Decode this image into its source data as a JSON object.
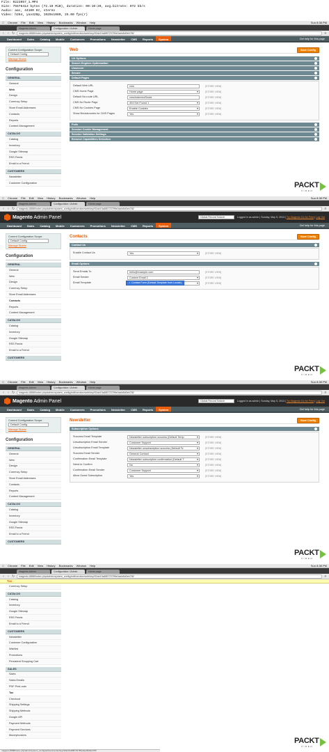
{
  "meta": {
    "lines": [
      "File: 0223057_1.MP4",
      "Size: 75576413 bytes (72.10 MiB), duration: 00:10:20, avg.bitrate: 972 kb/s",
      "Audio: aac, 44100 Hz, stereo",
      "Video: h264, yuv420p, 1920x1080, 25.00 fps(r)"
    ]
  },
  "macbar": {
    "apple": "",
    "items": [
      "Chrome",
      "File",
      "Edit",
      "View",
      "History",
      "Bookmarks",
      "Window",
      "Help"
    ],
    "right": "Sun 8:38 PM"
  },
  "browser": {
    "tabs": [
      "Magento Admin",
      "Configuration / Admin",
      "Home page"
    ],
    "url": "magento.8888/index.php/admin/system_config/edit/section/web/key/92ab19a8f87237ff9e0aeb8d0eb7f8/"
  },
  "header": {
    "logo": "Magento",
    "logo_suffix": "Admin Panel",
    "search_value": "Global Record Search",
    "logged_in": "Logged in as admin",
    "date": "Sunday, May 5, 2013",
    "try_link": "Try Magento Go for Free",
    "logout": "Log Out"
  },
  "nav": {
    "items": [
      "Dashboard",
      "Sales",
      "Catalog",
      "Mobile",
      "Customers",
      "Promotions",
      "Newsletter",
      "CMS",
      "Reports",
      "System"
    ],
    "active": "System",
    "help": "Get help for this page"
  },
  "sidebar": {
    "scope_label": "Current Configuration Scope:",
    "scope_value": "Default Config",
    "manage_stores": "Manage Stores",
    "title": "Configuration",
    "general_head": "GENERAL",
    "general_items": [
      "General",
      "Web",
      "Design",
      "Currency Setup",
      "Store Email Addresses",
      "Contacts",
      "Reports",
      "Content Management"
    ],
    "catalog_head": "CATALOG",
    "catalog_items": [
      "Catalog",
      "Inventory",
      "Google Sitemap",
      "RSS Feeds",
      "Email to a Friend"
    ],
    "customers_head": "CUSTOMERS",
    "customers_items": [
      "Newsletter",
      "Customer Configuration"
    ],
    "customers_items_full": [
      "Newsletter",
      "Customer Configuration",
      "Wishlist",
      "Promotions",
      "Persistent Shopping Cart"
    ],
    "sales_head": "SALES",
    "sales_items": [
      "Sales",
      "Sales Emails",
      "PDF Print-outs",
      "Tax",
      "Checkout",
      "Shipping Settings",
      "Shipping Methods",
      "Google API",
      "Payment Methods",
      "Payment Services",
      "Moneybookers"
    ]
  },
  "save_label": "Save Config",
  "store_view": "[STORE VIEW]",
  "web": {
    "title": "Web",
    "sections_top": [
      "Url Options",
      "Search Engines Optimization",
      "Unsecure",
      "Secure",
      "Default Pages"
    ],
    "rows": [
      {
        "label": "Default Web URL",
        "value": "cms"
      },
      {
        "label": "CMS Home Page",
        "value": "Home page"
      },
      {
        "label": "Default No-route URL",
        "value": "cms/index/noRoute"
      },
      {
        "label": "CMS No Route Page",
        "value": "404 Not Found 1"
      },
      {
        "label": "CMS No Cookies Page",
        "value": "Enable Cookies"
      },
      {
        "label": "Show Breadcrumbs for CMS Pages",
        "value": "Yes"
      }
    ],
    "sections_bottom": [
      "Polls",
      "Session Cookie Management",
      "Session Validation Settings",
      "Browser Capabilities Detection"
    ]
  },
  "contacts": {
    "title": "Contacts",
    "contact_us_head": "Contact Us",
    "enable_label": "Enable Contact Us",
    "enable_value": "Yes",
    "email_options_head": "Email Options",
    "rows": [
      {
        "label": "Send Emails To",
        "value": "hello@example.com"
      },
      {
        "label": "Email Sender",
        "value": "Custom Email 2"
      },
      {
        "label": "Email Template",
        "value": ""
      }
    ],
    "dropdown_option": "✓ Contact Form (Default Template from Locale)"
  },
  "newsletter": {
    "title": "Newsletter",
    "section_head": "Subscription Options",
    "rows": [
      {
        "label": "Success Email Template",
        "value": "Newsletter subscription success (Default Temp"
      },
      {
        "label": "Unsubscription Email Sender",
        "value": "Customer Support"
      },
      {
        "label": "Unsubscription Email Template",
        "value": "Newsletter unsubscription success (Default Te"
      },
      {
        "label": "Success Email Sender",
        "value": "General Contact"
      },
      {
        "label": "Confirmation Email Template",
        "value": "Newsletter subscription confirmation (Default T"
      },
      {
        "label": "Need to Confirm",
        "value": "No"
      },
      {
        "label": "Confirmation Email Sender",
        "value": "Customer Support"
      },
      {
        "label": "Allow Guest Subscription",
        "value": "Yes"
      }
    ]
  },
  "tax": {
    "title": "Tax",
    "top_item": "Currency Setup"
  },
  "packt": {
    "word": "PACKT",
    "sub": "VIDEO"
  },
  "statusbar": "magento.8888/index.php/admin/system_config/edit/section/tax/key/92ab19a8f87237ff9e0aeb8d0eb7f8/"
}
